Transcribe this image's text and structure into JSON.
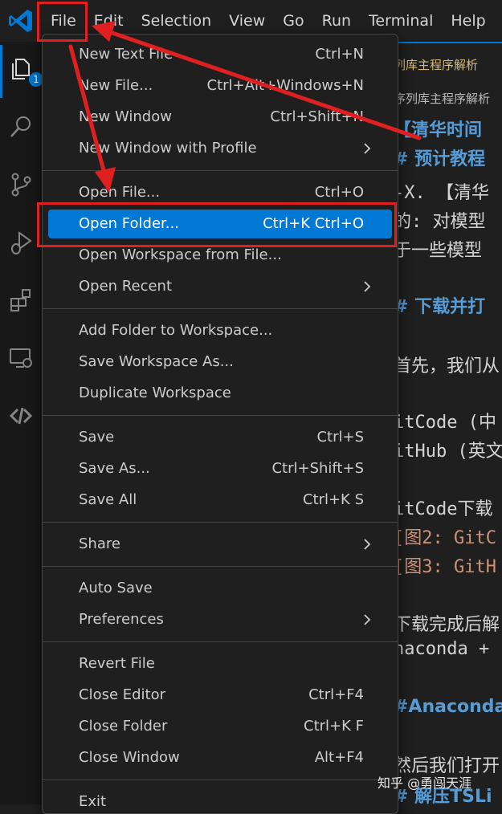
{
  "menubar": {
    "items": [
      "File",
      "Edit",
      "Selection",
      "View",
      "Go",
      "Run",
      "Terminal",
      "Help"
    ]
  },
  "activitybar": {
    "explorer_badge": "1",
    "icons": [
      "explorer-icon",
      "search-icon",
      "source-control-icon",
      "run-debug-icon",
      "extensions-icon",
      "remote-explorer-icon",
      "remote-connection-icon"
    ]
  },
  "editor": {
    "lines": [
      "列库主程序解析",
      "序列库主程序解析",
      "【清华时间",
      "# 预计教程",
      "-X. 【清华",
      "的: 对模型",
      "于一些模型",
      "# 下载并打",
      "首先，我们从",
      "itCode (中",
      "itHub (英文",
      "itCode下载",
      "[图2: GitC",
      "[图3: GitH",
      "下载完成后解",
      "naconda +",
      "#Anaconda",
      "然后我们打开",
      "# 解压TSLi"
    ]
  },
  "file_menu": {
    "groups": [
      [
        {
          "label": "New Text File",
          "shortcut": "Ctrl+N"
        },
        {
          "label": "New File...",
          "shortcut": "Ctrl+Alt+Windows+N"
        },
        {
          "label": "New Window",
          "shortcut": "Ctrl+Shift+N"
        },
        {
          "label": "New Window with Profile",
          "submenu": true
        }
      ],
      [
        {
          "label": "Open File...",
          "shortcut": "Ctrl+O"
        },
        {
          "label": "Open Folder...",
          "shortcut": "Ctrl+K Ctrl+O",
          "active": true
        },
        {
          "label": "Open Workspace from File..."
        },
        {
          "label": "Open Recent",
          "submenu": true
        }
      ],
      [
        {
          "label": "Add Folder to Workspace..."
        },
        {
          "label": "Save Workspace As..."
        },
        {
          "label": "Duplicate Workspace"
        }
      ],
      [
        {
          "label": "Save",
          "shortcut": "Ctrl+S"
        },
        {
          "label": "Save As...",
          "shortcut": "Ctrl+Shift+S"
        },
        {
          "label": "Save All",
          "shortcut": "Ctrl+K S"
        }
      ],
      [
        {
          "label": "Share",
          "submenu": true
        }
      ],
      [
        {
          "label": "Auto Save"
        },
        {
          "label": "Preferences",
          "submenu": true
        }
      ],
      [
        {
          "label": "Revert File"
        },
        {
          "label": "Close Editor",
          "shortcut": "Ctrl+F4"
        },
        {
          "label": "Close Folder",
          "shortcut": "Ctrl+K F"
        },
        {
          "label": "Close Window",
          "shortcut": "Alt+F4"
        }
      ],
      [
        {
          "label": "Exit"
        }
      ]
    ]
  },
  "annotation": {
    "color": "#e02020"
  },
  "watermark": "知乎 @勇闯天涯",
  "colors": {
    "accent": "#0078d4",
    "menu_bg": "#1f1f1f",
    "activity_bg": "#181818",
    "heading": "#569cd6",
    "string": "#ce9178"
  }
}
